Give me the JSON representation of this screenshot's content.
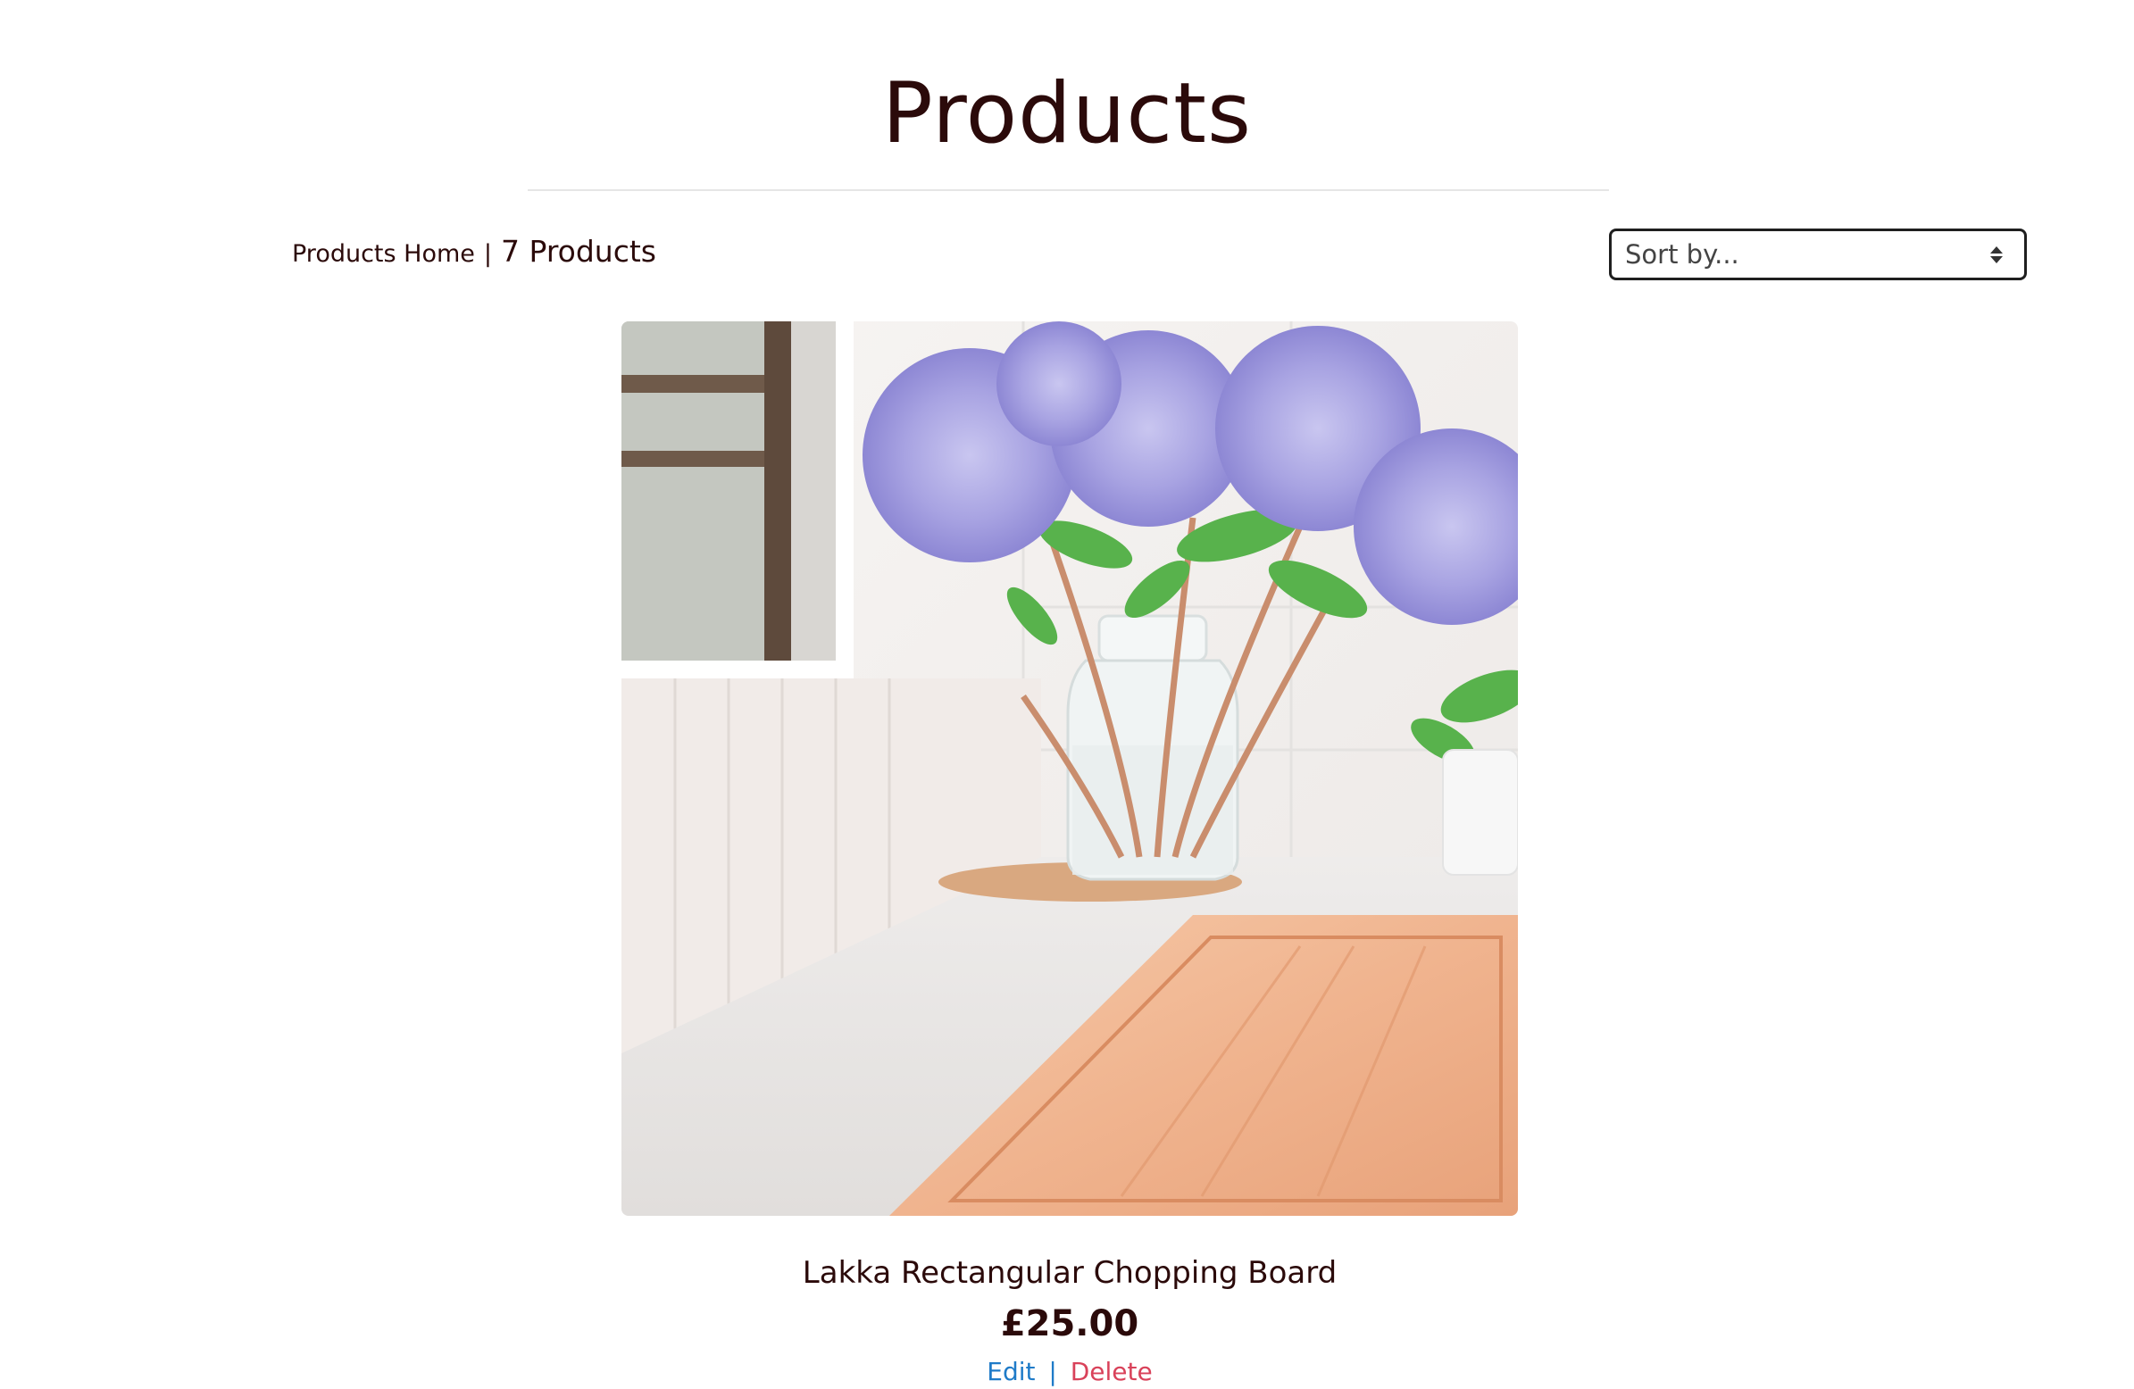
{
  "page": {
    "title": "Products"
  },
  "breadcrumb": {
    "home_label": "Products Home",
    "separator": "|",
    "count_label": "7 Products"
  },
  "sort": {
    "selected_label": "Sort by..."
  },
  "product": {
    "name": "Lakka Rectangular Chopping Board",
    "price": "£25.00",
    "edit_label": "Edit",
    "action_separator": "|",
    "delete_label": "Delete",
    "image_alt": "Lakka Rectangular Chopping Board"
  },
  "colors": {
    "text_dark": "#2b0a0a",
    "edit_link": "#1f7bc8",
    "delete_link": "#d9425a"
  }
}
